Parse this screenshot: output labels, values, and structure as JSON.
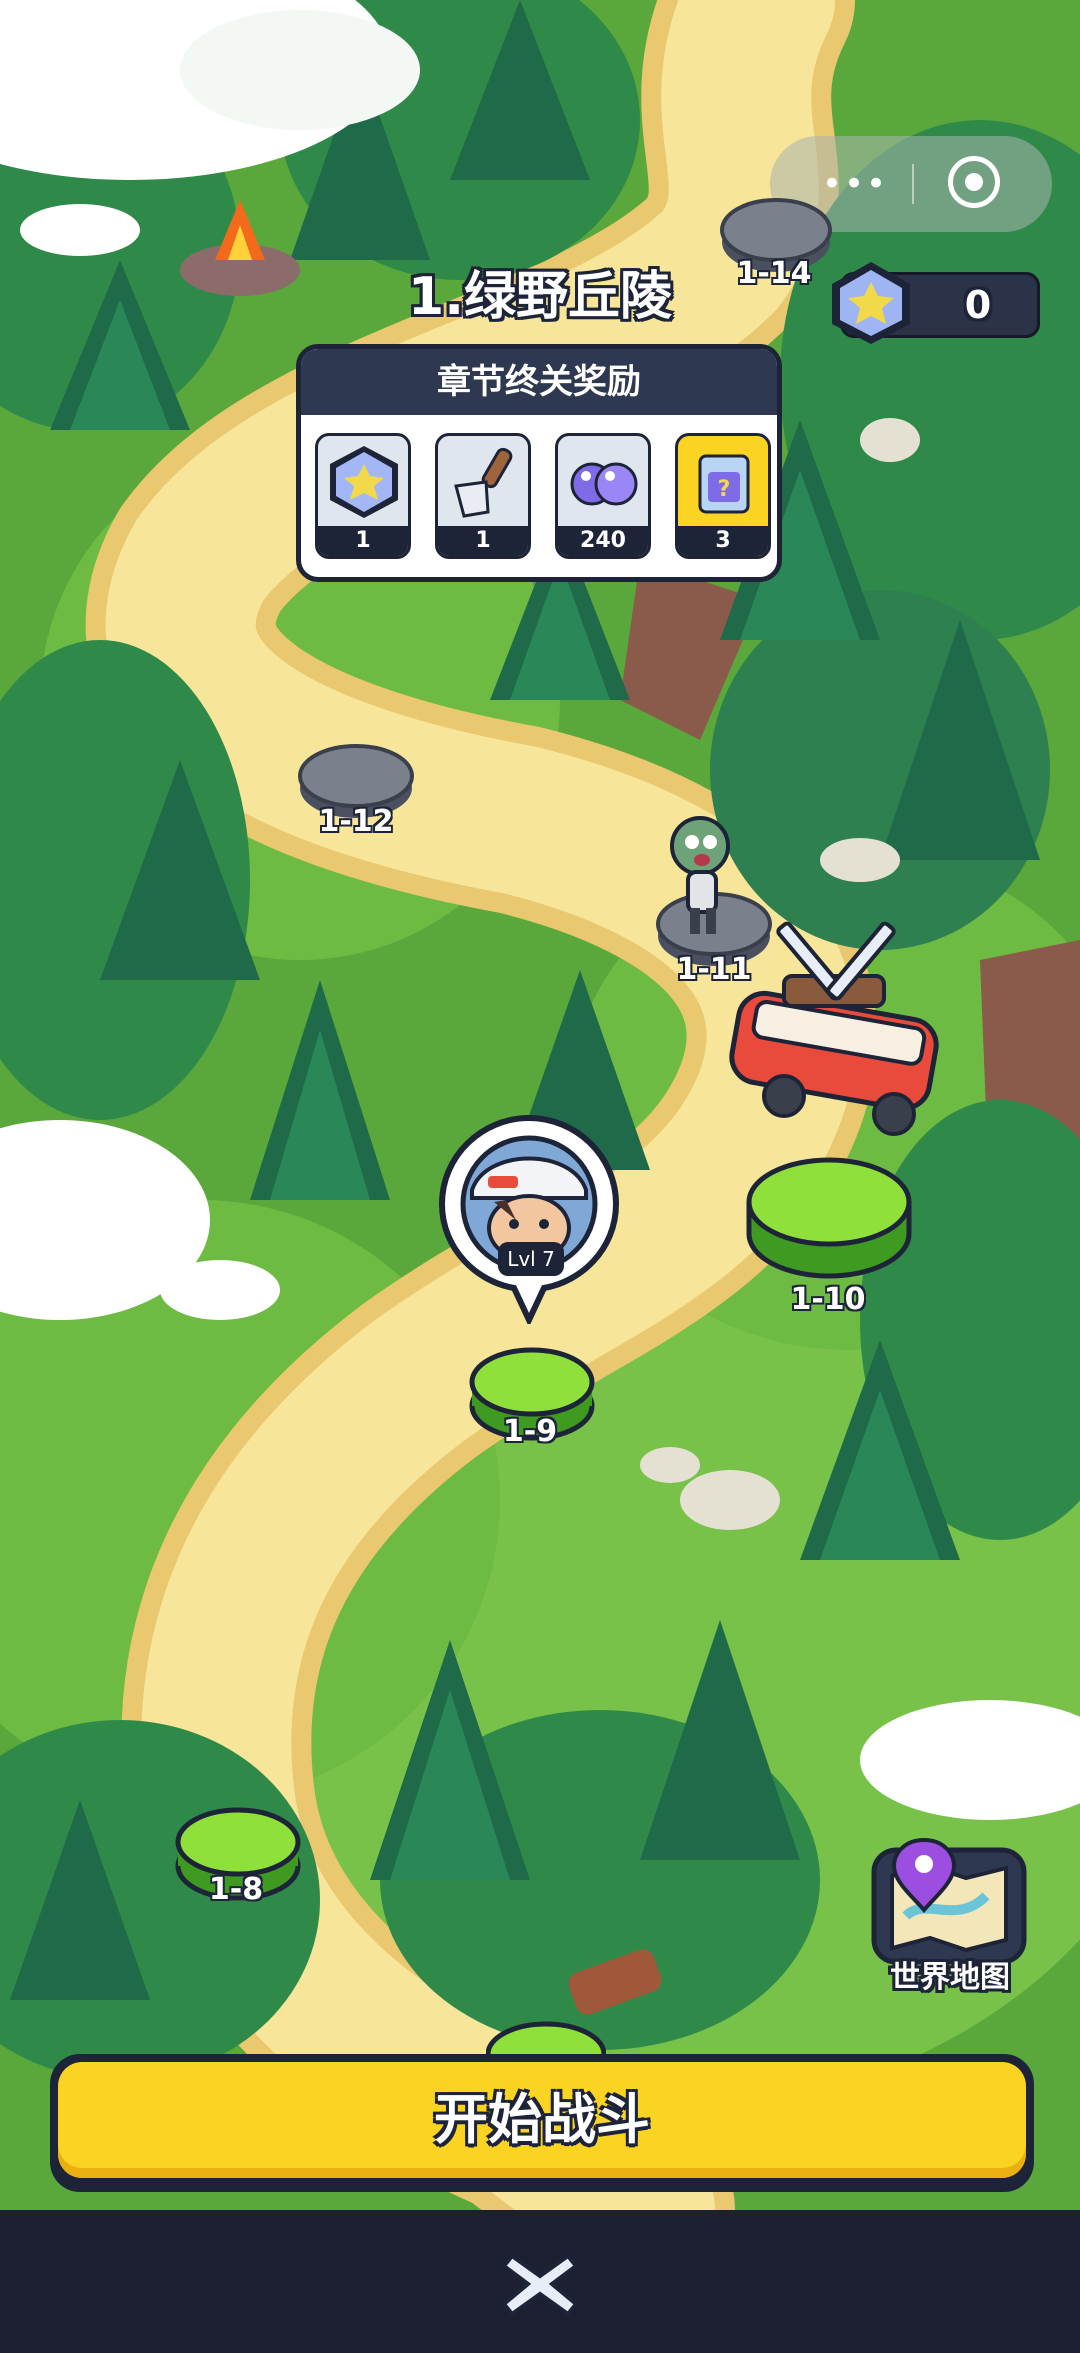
{
  "chapter": {
    "title": "1.绿野丘陵"
  },
  "currency": {
    "gem_count": "0"
  },
  "reward_panel": {
    "header": "章节终关奖励",
    "items": [
      {
        "icon": "star-gem-icon",
        "qty": "1"
      },
      {
        "icon": "shovel-icon",
        "qty": "1"
      },
      {
        "icon": "purple-orbs-icon",
        "qty": "240"
      },
      {
        "icon": "mystery-box-icon",
        "qty": "3"
      }
    ]
  },
  "levels": [
    {
      "id": "1-14",
      "state": "locked"
    },
    {
      "id": "1-12",
      "state": "locked"
    },
    {
      "id": "1-11",
      "state": "locked"
    },
    {
      "id": "1-10",
      "state": "unlocked"
    },
    {
      "id": "1-9",
      "state": "current"
    },
    {
      "id": "1-8",
      "state": "unlocked"
    }
  ],
  "player": {
    "level_badge": "Lvl 7"
  },
  "world_map": {
    "label": "世界地图"
  },
  "start_button": {
    "label": "开始战斗"
  },
  "colors": {
    "accent": "#fbd322",
    "unlocked_node": "#8fe03a",
    "locked_node": "#7a808c",
    "dark": "#1d2438"
  }
}
